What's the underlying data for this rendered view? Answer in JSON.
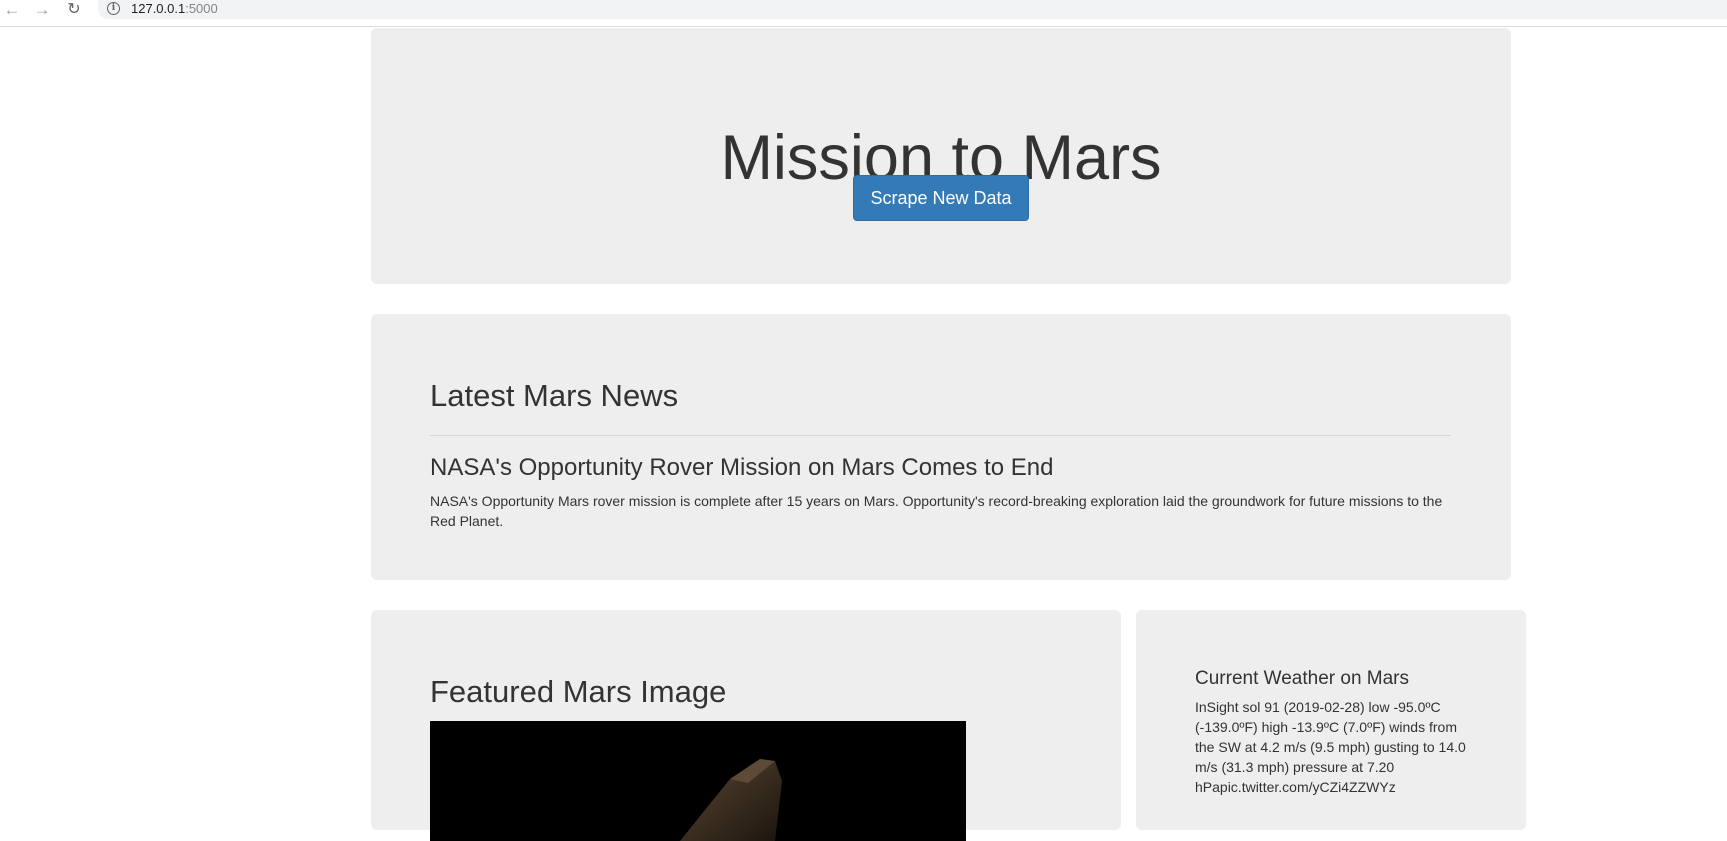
{
  "browser": {
    "url_host": "127.0.0.1",
    "url_port": ":5000",
    "back_glyph": "←",
    "forward_glyph": "→",
    "reload_glyph": "↻",
    "info_glyph": "i"
  },
  "hero": {
    "title": "Mission to Mars",
    "button_label": "Scrape New Data",
    "button_color": "#337ab7"
  },
  "news": {
    "heading": "Latest Mars News",
    "title": "NASA's Opportunity Rover Mission on Mars Comes to End",
    "paragraph": "NASA's Opportunity Mars rover mission is complete after 15 years on Mars. Opportunity's record-breaking exploration laid the groundwork for future missions to the Red Planet."
  },
  "featured_image": {
    "heading": "Featured Mars Image"
  },
  "weather": {
    "heading": "Current Weather on Mars",
    "text": "InSight sol 91 (2019-02-28) low -95.0ºC (-139.0ºF) high -13.9ºC (7.0ºF) winds from the SW at 4.2 m/s (9.5 mph) gusting to 14.0 m/s (31.3 mph) pressure at 7.20 hPapic.twitter.com/yCZi4ZZWYz"
  },
  "colors": {
    "panel_background": "#eeeeee",
    "text": "#333333"
  }
}
